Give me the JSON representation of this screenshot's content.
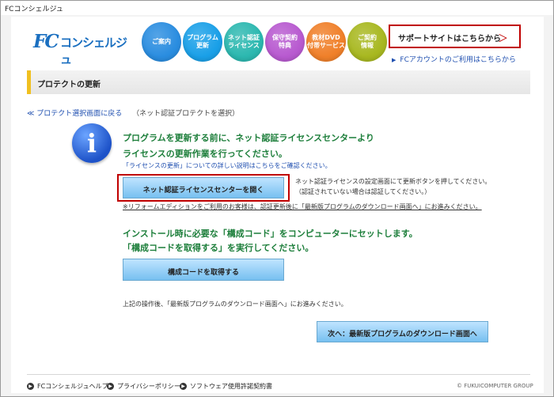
{
  "window": {
    "title": "FCコンシェルジュ"
  },
  "header": {
    "logo_fc": "FC",
    "logo_name": "コンシェルジュ",
    "nav": [
      {
        "label": "ご案内",
        "color": "#2a8de0"
      },
      {
        "label": "プログラム\n更新",
        "color": "#1aa0e8"
      },
      {
        "label": "ネット認証\nライセンス",
        "color": "#2cb8b0"
      },
      {
        "label": "保守契約\n特典",
        "color": "#b85ad0"
      },
      {
        "label": "教材DVD\n付帯サービス",
        "color": "#f0802a"
      },
      {
        "label": "ご契約\n情報",
        "color": "#a8b820"
      }
    ],
    "support_label": "サポートサイトはこちらから",
    "support_chevron": "＞",
    "fc_account_link": "FCアカウントのご利用はこちらから"
  },
  "section": {
    "title": "プロテクトの更新"
  },
  "back": {
    "link": "≪ プロテクト選択画面に戻る",
    "note": "（ネット認証プロテクトを選択）"
  },
  "info": {
    "icon": "info-icon",
    "glyph": "i",
    "line1": "プログラムを更新する前に、ネット認証ライセンスセンターより",
    "line2": "ライセンスの更新作業を行ってください。",
    "detail_link": "「ライセンスの更新」についての詳しい説明はこちらをご確認ください。"
  },
  "license": {
    "button": "ネット認証ライセンスセンターを開く",
    "note1": "ネット認証ライセンスの設定画面にて更新ボタンを押してください。",
    "note2": "（認証されていない場合は認証してください。）",
    "reform_link": "※リフォームエディションをご利用のお客様は、認証更新後に「最新版プログラムのダウンロード画面へ」にお進みください。"
  },
  "config": {
    "line1": "インストール時に必要な「構成コード」をコンピューターにセットします。",
    "line2": "「構成コードを取得する」を実行してください。",
    "button": "構成コードを取得する"
  },
  "after_text": "上記の操作後、「最新版プログラムのダウンロード画面へ」にお進みください。",
  "next_button": "次へ：最新版プログラムのダウンロード画面へ",
  "footer": {
    "links": [
      "FCコンシェルジュヘルプ",
      "プライバシーポリシー",
      "ソフトウェア使用許諾契約書"
    ],
    "copyright": "© FUKUICOMPUTER GROUP"
  }
}
